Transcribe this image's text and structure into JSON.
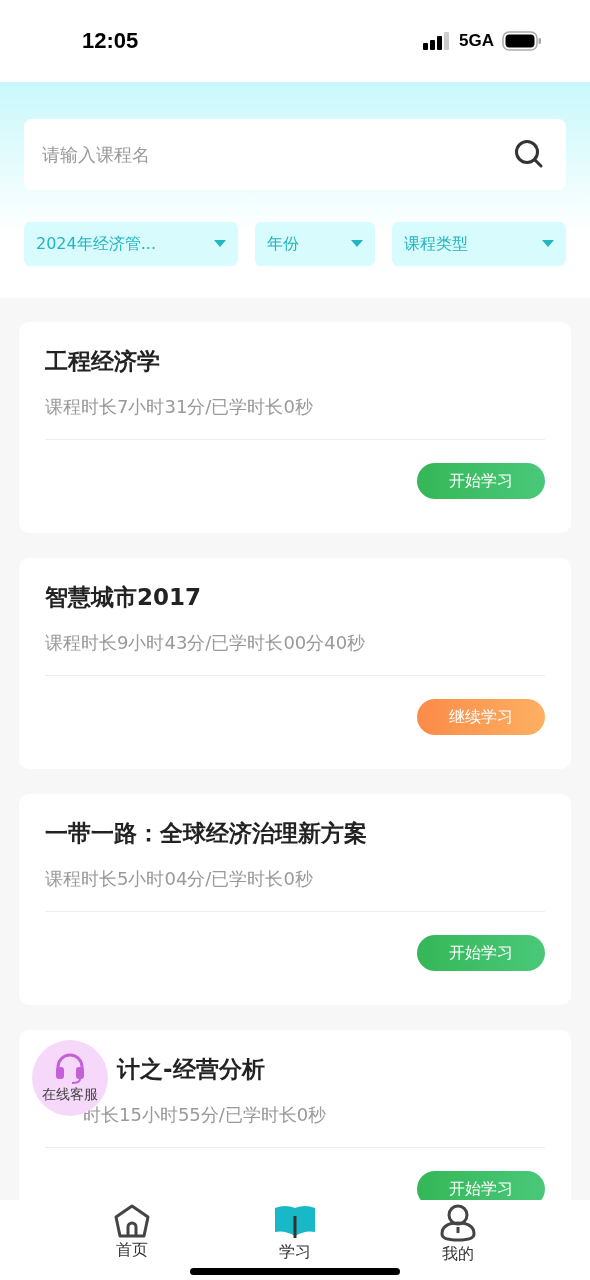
{
  "status_bar": {
    "time": "12:05",
    "network": "5GA"
  },
  "search": {
    "placeholder": "请输入课程名"
  },
  "filters": [
    {
      "label": "2024年经济管..."
    },
    {
      "label": "年份"
    },
    {
      "label": "课程类型"
    }
  ],
  "courses": [
    {
      "title": "工程经济学",
      "duration": "课程时长7小时31分/已学时长0秒",
      "action": {
        "kind": "start",
        "label": "开始学习"
      }
    },
    {
      "title": "智慧城市2017",
      "duration": "课程时长9小时43分/已学时长00分40秒",
      "action": {
        "kind": "continue",
        "label": "继续学习"
      }
    },
    {
      "title": "一带一路：全球经济治理新方案",
      "duration": "课程时长5小时04分/已学时长0秒",
      "action": {
        "kind": "start",
        "label": "开始学习"
      }
    },
    {
      "title": "计之-经营分析",
      "duration": "时长15小时55分/已学时长0秒",
      "partly_covered": true,
      "action": {
        "kind": "start",
        "label": "开始学习"
      }
    }
  ],
  "support_button": {
    "label": "在线客服"
  },
  "tab_bar": [
    {
      "label": "首页",
      "selected": false
    },
    {
      "label": "学习",
      "selected": true
    },
    {
      "label": "我的",
      "selected": false
    }
  ]
}
